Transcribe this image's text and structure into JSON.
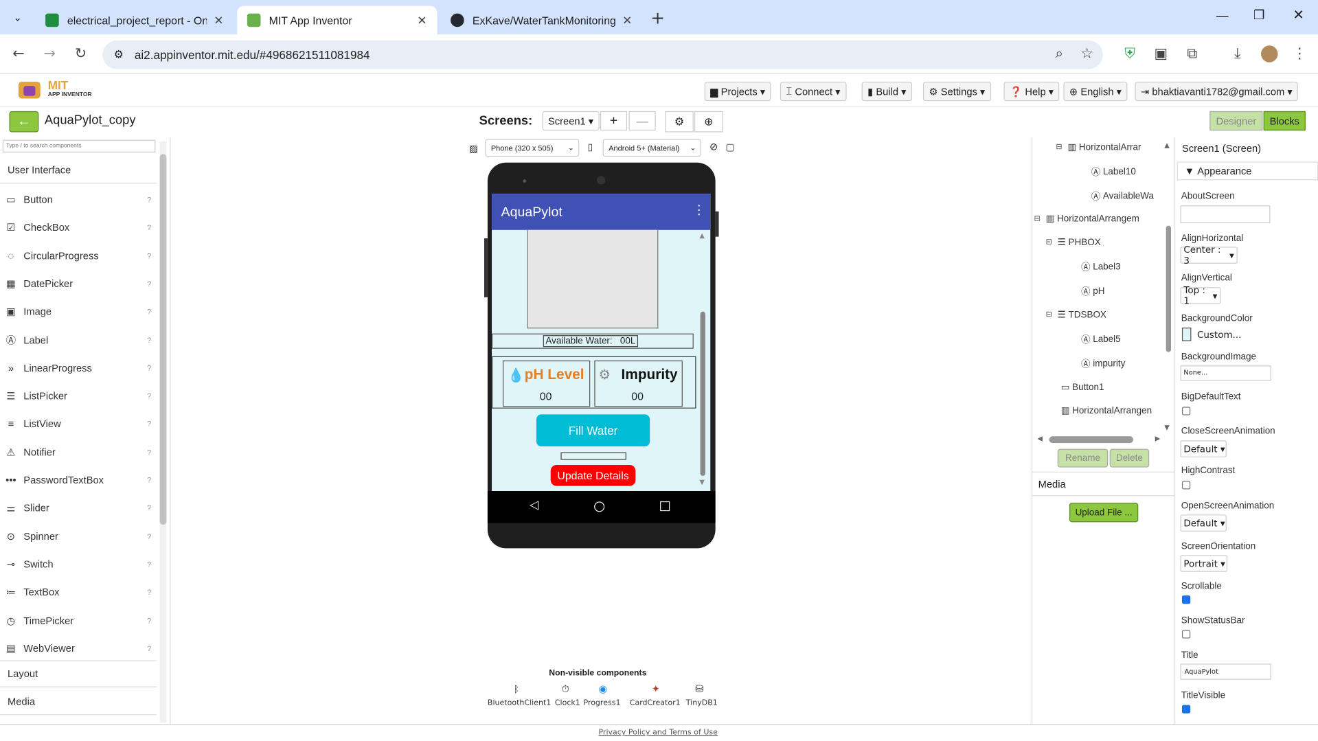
{
  "browser": {
    "tabs": [
      {
        "title": "electrical_project_report - Onlin",
        "favicon_color": "#1e8e3e"
      },
      {
        "title": "MIT App Inventor",
        "favicon_color": "#6ab04c"
      },
      {
        "title": "ExKave/WaterTankMonitoring",
        "favicon_color": "#24292f"
      }
    ],
    "url": "ai2.appinventor.mit.edu/#4968621511081984"
  },
  "app": {
    "logo_top": "MIT",
    "logo_bottom": "APP INVENTOR",
    "menus": [
      "Projects",
      "Connect",
      "Build",
      "Settings",
      "Help",
      "English",
      "bhaktiavanti1782@gmail.com"
    ],
    "project_name": "AquaPylot_copy",
    "screens_label": "Screens:",
    "screen_select": "Screen1",
    "designer_label": "Designer",
    "blocks_label": "Blocks"
  },
  "palette": {
    "search_placeholder": "Type / to search components",
    "category": "User Interface",
    "items": [
      "Button",
      "CheckBox",
      "CircularProgress",
      "DatePicker",
      "Image",
      "Label",
      "LinearProgress",
      "ListPicker",
      "ListView",
      "Notifier",
      "PasswordTextBox",
      "Slider",
      "Spinner",
      "Switch",
      "TextBox",
      "TimePicker",
      "WebViewer"
    ],
    "sections": [
      "Layout",
      "Media"
    ]
  },
  "viewer": {
    "device_select": "Phone (320 x 505)",
    "theme_select": "Android 5+ (Material)",
    "app_title": "AquaPylot",
    "available_water": "Available Water:   00L",
    "ph_title": "pH Level",
    "ph_value": "00",
    "impurity_title": "Impurity",
    "impurity_value": "00",
    "fill_button": "Fill Water",
    "update_button": "Update Details",
    "nonvisible_title": "Non-visible components",
    "nonvisible": [
      "BluetoothClient1",
      "Clock1",
      "Progress1",
      "CardCreator1",
      "TinyDB1"
    ],
    "footer": "Privacy Policy and Terms of Use"
  },
  "tree": {
    "items": [
      "HorizontalArrar",
      "Label10",
      "AvailableWa",
      "HorizontalArrangem",
      "PHBOX",
      "Label3",
      "pH",
      "TDSBOX",
      "Label5",
      "impurity",
      "Button1",
      "HorizontalArrangen"
    ],
    "rename": "Rename",
    "delete": "Delete",
    "media_title": "Media",
    "upload": "Upload File ..."
  },
  "properties": {
    "header": "Screen1 (Screen)",
    "group": "Appearance",
    "about": "AboutScreen",
    "align_h": "AlignHorizontal",
    "align_h_val": "Center : 3",
    "align_v": "AlignVertical",
    "align_v_val": "Top : 1",
    "bg_color": "BackgroundColor",
    "bg_color_val": "Custom...",
    "bg_image": "BackgroundImage",
    "bg_image_val": "None...",
    "big_text": "BigDefaultText",
    "close_anim": "CloseScreenAnimation",
    "close_anim_val": "Default",
    "high_contrast": "HighContrast",
    "open_anim": "OpenScreenAnimation",
    "open_anim_val": "Default",
    "orientation": "ScreenOrientation",
    "orientation_val": "Portrait",
    "scrollable": "Scrollable",
    "status_bar": "ShowStatusBar",
    "title": "Title",
    "title_val": "AquaPylot",
    "title_visible": "TitleVisible"
  }
}
